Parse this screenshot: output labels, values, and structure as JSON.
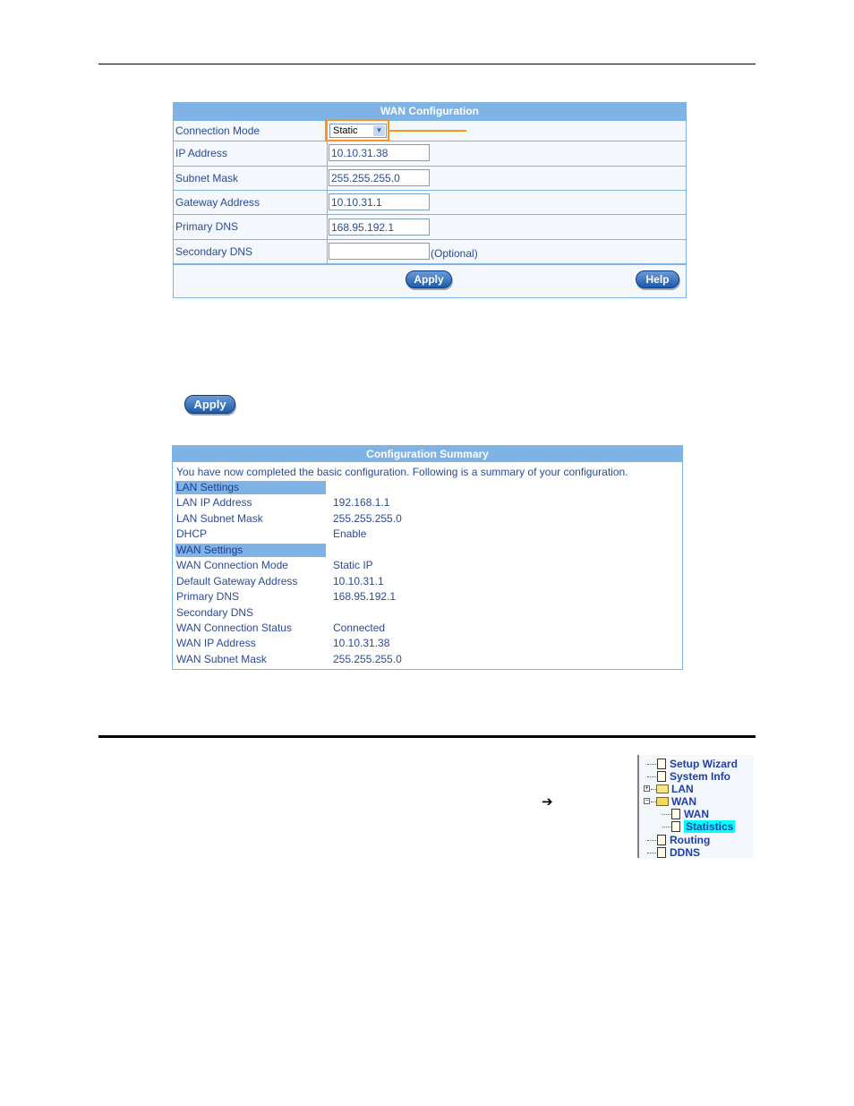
{
  "wan_config": {
    "title": "WAN Configuration",
    "fields": [
      {
        "label": "Connection Mode",
        "type": "select",
        "value": "Static"
      },
      {
        "label": "IP Address",
        "type": "text",
        "value": "10.10.31.38"
      },
      {
        "label": "Subnet Mask",
        "type": "text",
        "value": "255.255.255.0"
      },
      {
        "label": "Gateway Address",
        "type": "text",
        "value": "10.10.31.1"
      },
      {
        "label": "Primary DNS",
        "type": "text",
        "value": "168.95.192.1"
      },
      {
        "label": "Secondary DNS",
        "type": "text",
        "value": "",
        "hint": "(Optional)"
      }
    ],
    "apply_label": "Apply",
    "help_label": "Help",
    "highlight_color": "#f7941d"
  },
  "standalone_apply_label": "Apply",
  "summary": {
    "title": "Configuration Summary",
    "intro": "You have now completed the basic configuration. Following is a summary of your configuration.",
    "lan_section": "LAN Settings",
    "lan_rows": [
      {
        "label": "LAN IP Address",
        "value": "192.168.1.1"
      },
      {
        "label": "LAN Subnet Mask",
        "value": "255.255.255.0"
      },
      {
        "label": "DHCP",
        "value": "Enable"
      }
    ],
    "wan_section": "WAN Settings",
    "wan_rows": [
      {
        "label": "WAN Connection Mode",
        "value": "Static IP"
      },
      {
        "label": "Default Gateway Address",
        "value": "10.10.31.1"
      },
      {
        "label": "Primary DNS",
        "value": "168.95.192.1"
      },
      {
        "label": "Secondary DNS",
        "value": ""
      },
      {
        "label": "WAN Connection Status",
        "value": "Connected"
      },
      {
        "label": "WAN IP Address",
        "value": "10.10.31.38"
      },
      {
        "label": "WAN Subnet Mask",
        "value": "255.255.255.0"
      }
    ]
  },
  "arrow_glyph": "➔",
  "nav_tree": {
    "items": [
      {
        "label": "Setup Wizard",
        "icon": "document-icon"
      },
      {
        "label": "System Info",
        "icon": "document-icon"
      },
      {
        "label": "LAN",
        "icon": "folder-icon",
        "expander": "+"
      },
      {
        "label": "WAN",
        "icon": "folder-open-icon",
        "expander": "−"
      },
      {
        "label": "WAN",
        "icon": "document-icon",
        "child": true
      },
      {
        "label": "Statistics",
        "icon": "document-icon",
        "child": true,
        "selected": true
      },
      {
        "label": "Routing",
        "icon": "document-icon"
      },
      {
        "label": "DDNS",
        "icon": "document-icon"
      }
    ]
  }
}
